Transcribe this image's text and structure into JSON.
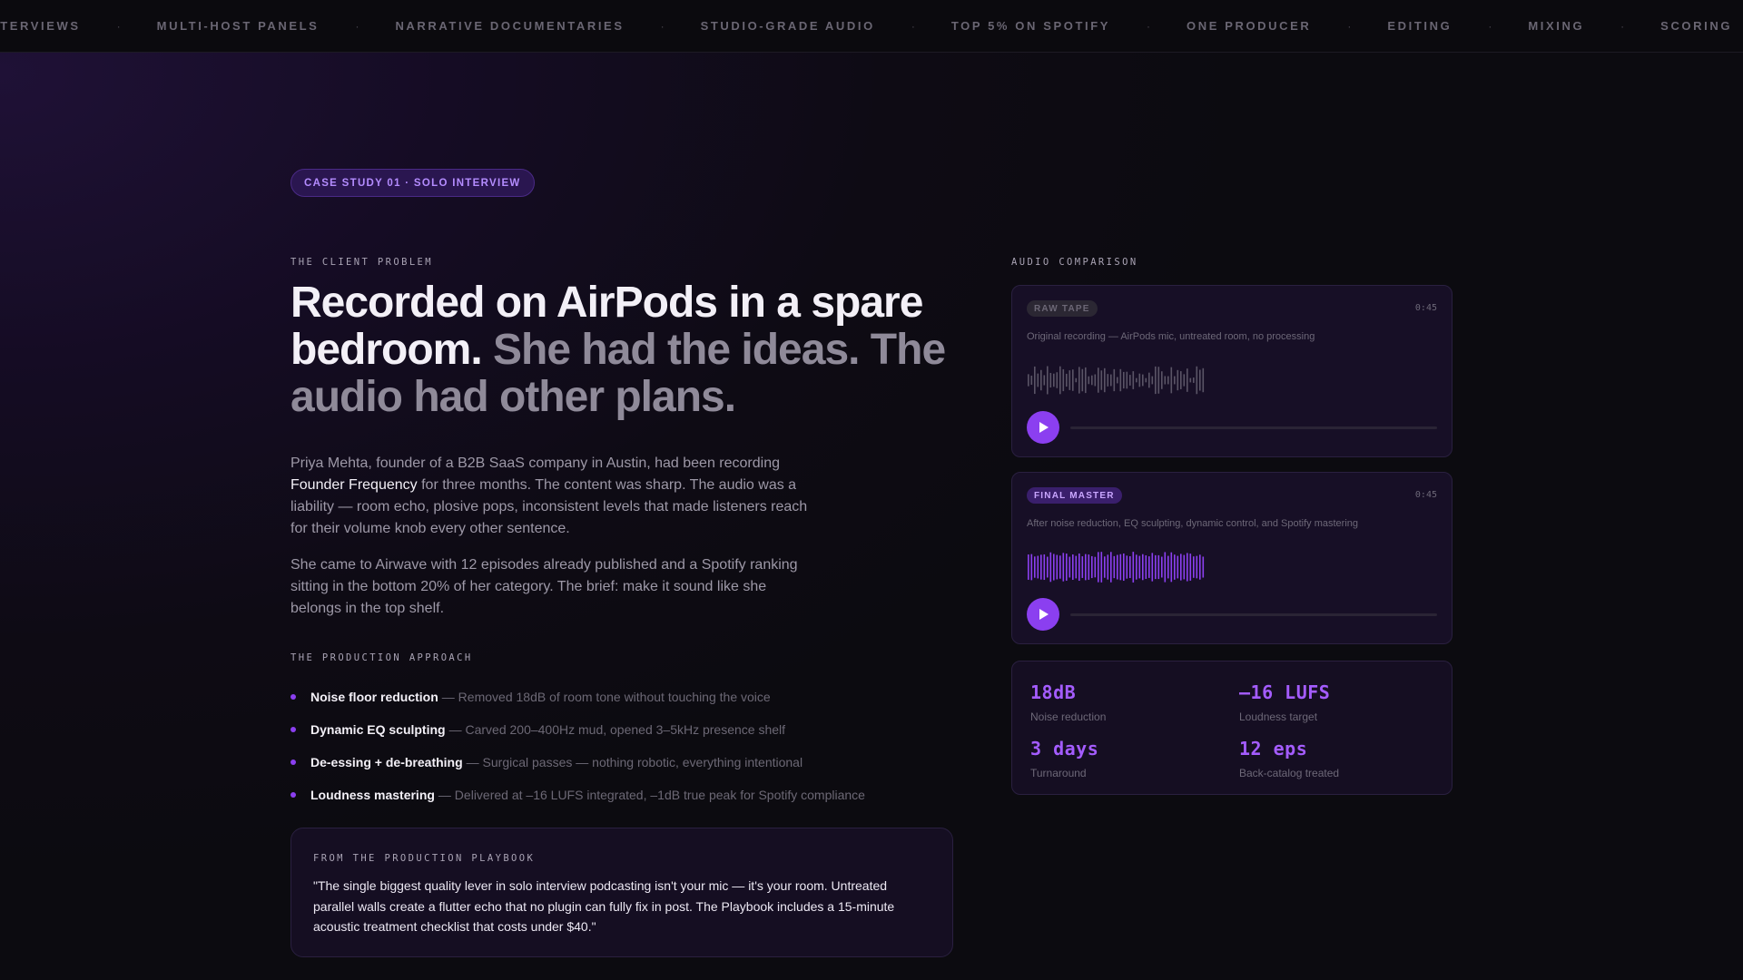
{
  "ticker": [
    "Interviews",
    "Multi-host panels",
    "Narrative documentaries",
    "Studio-grade audio",
    "Top 5% on Spotify",
    "One producer",
    "Editing",
    "Mixing",
    "Scoring"
  ],
  "ticker_separator": "·",
  "badge": "CASE STUDY 01 · SOLO INTERVIEW",
  "problem": {
    "eyebrow": "THE CLIENT PROBLEM",
    "headline_bright": "Recorded on AirPods in a spare bedroom.",
    "headline_dim": "She had the ideas. The audio had other plans.",
    "p1_a": "Priya Mehta, founder of a B2B SaaS company in Austin, had been recording",
    "p1_highlight": "Founder Frequency",
    "p1_b": "for three months. The content was sharp. The audio was a liability — room echo, plosive pops, inconsistent levels that made listeners reach for their volume knob every other sentence.",
    "p2": "She came to Airwave with 12 episodes already published and a Spotify ranking sitting in the bottom 20% of her category. The brief: make it sound like she belongs in the top shelf."
  },
  "approach": {
    "eyebrow": "THE PRODUCTION APPROACH",
    "items": [
      {
        "title": "Noise floor reduction",
        "detail": "— Removed 18dB of room tone without touching the voice"
      },
      {
        "title": "Dynamic EQ sculpting",
        "detail": "— Carved 200–400Hz mud, opened 3–5kHz presence shelf"
      },
      {
        "title": "De-essing + de-breathing",
        "detail": "— Surgical passes — nothing robotic, everything intentional"
      },
      {
        "title": "Loudness mastering",
        "detail": "— Delivered at –16 LUFS integrated, –1dB true peak for Spotify compliance"
      }
    ]
  },
  "playbook": {
    "eyebrow": "FROM THE PRODUCTION PLAYBOOK",
    "quote": "\"The single biggest quality lever in solo interview podcasting isn't your mic — it's your room. Untreated parallel walls create a flutter echo that no plugin can fully fix in post. The Playbook includes a 15-minute acoustic treatment checklist that costs under $40.\""
  },
  "comparison": {
    "eyebrow": "AUDIO COMPARISON",
    "raw": {
      "tag": "RAW TAPE",
      "time": "0:45",
      "desc": "Original recording — AirPods mic, untreated room, no processing",
      "progress": 0
    },
    "final": {
      "tag": "FINAL MASTER",
      "time": "0:45",
      "desc": "After noise reduction, EQ sculpting, dynamic control, and Spotify mastering",
      "progress": 0
    }
  },
  "stats": [
    {
      "value": "18dB",
      "label": "Noise reduction"
    },
    {
      "value": "–16 LUFS",
      "label": "Loudness target"
    },
    {
      "value": "3 days",
      "label": "Turnaround"
    },
    {
      "value": "12 eps",
      "label": "Back-catalog treated"
    }
  ],
  "colors": {
    "accent": "#8b3ff0",
    "accent_text": "#a45cff",
    "raw_wave": "#5a5466",
    "final_wave": "#8b3ff0"
  },
  "icons": {
    "play": "play-icon"
  }
}
